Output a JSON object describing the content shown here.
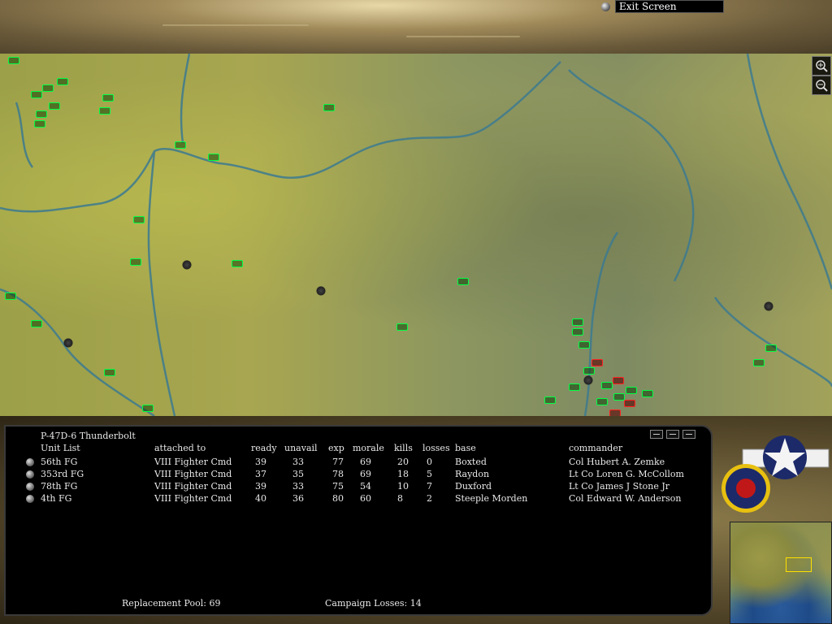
{
  "header": {
    "exit_button_label": "Exit Screen"
  },
  "map": {
    "zoom_in_icon": "zoom-in-icon",
    "zoom_out_icon": "zoom-out-icon"
  },
  "unit_panel": {
    "aircraft_type": "P-47D-6 Thunderbolt",
    "columns": [
      "Unit List",
      "attached to",
      "ready",
      "unavail",
      "exp",
      "morale",
      "kills",
      "losses",
      "base",
      "commander"
    ],
    "rows": [
      {
        "unit": "56th FG",
        "attached_to": "VIII Fighter Cmd",
        "ready": "39",
        "unavail": "33",
        "exp": "77",
        "morale": "69",
        "kills": "20",
        "losses": "0",
        "base": "Boxted",
        "commander": "Col Hubert A. Zemke"
      },
      {
        "unit": "353rd FG",
        "attached_to": "VIII Fighter Cmd",
        "ready": "37",
        "unavail": "35",
        "exp": "78",
        "morale": "69",
        "kills": "18",
        "losses": "5",
        "base": "Raydon",
        "commander": "Lt Co Loren G. McCollom"
      },
      {
        "unit": "78th FG",
        "attached_to": "VIII Fighter Cmd",
        "ready": "39",
        "unavail": "33",
        "exp": "75",
        "morale": "54",
        "kills": "10",
        "losses": "7",
        "base": "Duxford",
        "commander": "Lt Co James J Stone Jr"
      },
      {
        "unit": "4th FG",
        "attached_to": "VIII Fighter Cmd",
        "ready": "40",
        "unavail": "36",
        "exp": "80",
        "morale": "60",
        "kills": "8",
        "losses": "2",
        "base": "Steeple Morden",
        "commander": "Col Edward W. Anderson"
      }
    ],
    "replacement_pool": "Replacement Pool:  69",
    "campaign_losses": "Campaign Losses: 14"
  },
  "colors": {
    "friendly_unit": "#00ff44",
    "enemy_unit": "#ff2020",
    "minimap_view": "#ffe000"
  }
}
